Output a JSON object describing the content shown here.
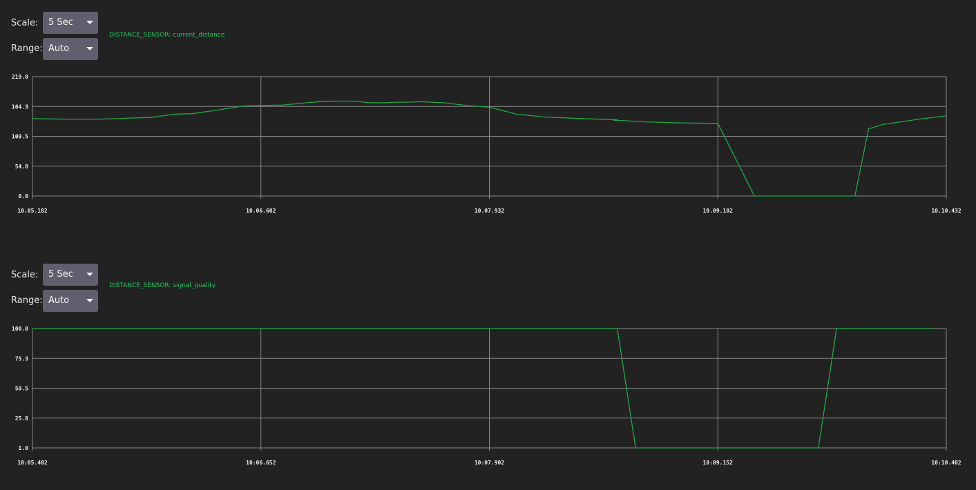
{
  "controls": {
    "scale_label": "Scale:",
    "range_label": "Range:"
  },
  "colors": {
    "background": "#222222",
    "grid": "#8a8a8a",
    "series": "#22a845",
    "legend_text": "#22c55e",
    "select_bg": "#5f5f6e"
  },
  "icons": [
    "chevron-down-icon"
  ],
  "panels": [
    {
      "scale_value": "5 Sec",
      "range_value": "Auto",
      "legend": "DISTANCE_SENSOR: current_distance"
    },
    {
      "scale_value": "5 Sec",
      "range_value": "Auto",
      "legend": "DISTANCE_SENSOR: signal_quality"
    }
  ],
  "chart_data": [
    {
      "type": "line",
      "title": "",
      "legend": [
        "DISTANCE_SENSOR: current_distance"
      ],
      "yticks": [
        "219.0",
        "164.3",
        "109.5",
        "54.8",
        "0.0"
      ],
      "xticks": [
        "10.05.182",
        "10.06.602",
        "10.07.932",
        "10.09.102",
        "10.10.432"
      ],
      "ylim": [
        0,
        219
      ],
      "grid": true,
      "series": [
        {
          "x": [
            0,
            0.035,
            0.075,
            0.11,
            0.13,
            0.155,
            0.175,
            0.2,
            0.23,
            0.25,
            0.275,
            0.3,
            0.315,
            0.333,
            0.35,
            0.37,
            0.385,
            0.4,
            0.41,
            0.425,
            0.45,
            0.475,
            0.49,
            0.5,
            0.53,
            0.56,
            0.6,
            0.64,
            0.635,
            0.65,
            0.67,
            0.71,
            0.75,
            0.79,
            0.82,
            0.86,
            0.875,
            0.9,
            0.915,
            0.93,
            0.95,
            0.97,
            1.0
          ],
          "y": [
            142,
            141,
            141,
            143,
            144,
            150,
            151,
            157,
            165,
            166,
            167,
            171,
            173,
            174,
            174,
            171,
            171,
            172,
            172,
            173,
            171,
            166,
            164,
            163,
            150,
            145,
            142,
            140,
            139,
            138,
            136,
            134,
            133,
            0,
            0,
            0,
            0,
            0,
            123,
            131,
            136,
            141,
            147
          ],
          "_note": ""
        }
      ]
    },
    {
      "type": "line",
      "title": "",
      "legend": [
        "DISTANCE_SENSOR: signal_quality"
      ],
      "yticks": [
        "100.0",
        "75.3",
        "50.5",
        "25.8",
        "1.0"
      ],
      "xticks": [
        "10:05.402",
        "10:06.652",
        "10:07.902",
        "10:09.152",
        "10:10.402"
      ],
      "ylim": [
        1,
        100
      ],
      "grid": true,
      "series": [
        {
          "x": [
            0,
            0.64,
            0.66,
            0.86,
            0.88,
            0.985
          ],
          "y": [
            100,
            100,
            1,
            1,
            100,
            100
          ]
        }
      ]
    }
  ]
}
